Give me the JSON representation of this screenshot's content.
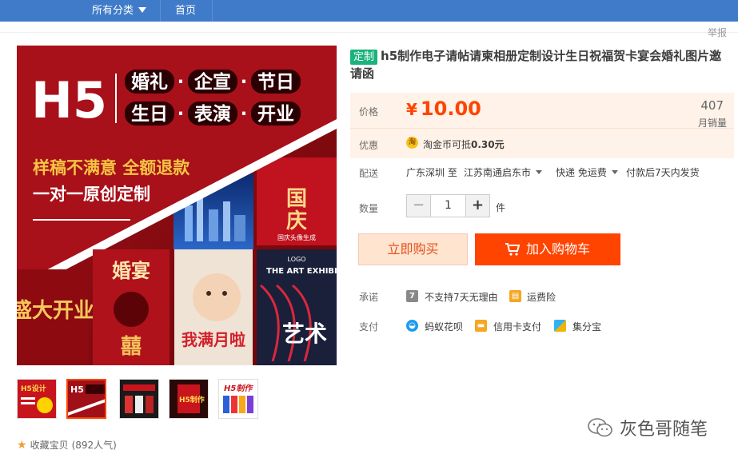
{
  "nav": {
    "categories": "所有分类",
    "home": "首页"
  },
  "report": "举报",
  "gallery": {
    "banner": {
      "h5": "H5",
      "chips_row1": [
        "婚礼",
        "·",
        "企宣",
        "·",
        "节日"
      ],
      "chips_row2": [
        "生日",
        "·",
        "表演",
        "·",
        "开业"
      ],
      "slogan1": "样稿不满意 全额退款",
      "slogan2": "一对一原创定制",
      "card_national": "国庆头像生成",
      "card_art": "THE ART EXHIBITION",
      "card_art_big": "艺术",
      "card_wedding": "婚宴",
      "card_baby": "我满月啦",
      "card_opening": "盛大开业",
      "logo": "LOGO"
    },
    "thumbs": [
      "H5设计",
      "H5",
      "",
      "H5制作",
      "H5制作"
    ]
  },
  "favorite": {
    "label": "收藏宝贝",
    "count": "(892人气)"
  },
  "product": {
    "tag": "定制",
    "title": "h5制作电子请帖请柬相册定制设计生日祝福贺卡宴会婚礼图片邀请函"
  },
  "price": {
    "label": "价格",
    "symbol": "¥",
    "value": "10.00",
    "sales": "407",
    "sales_label": "月销量"
  },
  "promo": {
    "label": "优惠",
    "coin": "淘",
    "text_pre": "淘金币可抵",
    "amount": "0.30元"
  },
  "delivery": {
    "label": "配送",
    "from": "广东深圳 至",
    "to": "江苏南通启东市",
    "method": "快递 免运费",
    "ship_time": "付款后7天内发货"
  },
  "quantity": {
    "label": "数量",
    "minus": "−",
    "value": "1",
    "plus": "+",
    "unit": "件"
  },
  "buttons": {
    "buy": "立即购买",
    "cart": "加入购物车"
  },
  "promise": {
    "label": "承诺",
    "items": [
      "不支持7天无理由",
      "运费险"
    ],
    "icon_seven": "7"
  },
  "payment": {
    "label": "支付",
    "items": [
      "蚂蚁花呗",
      "信用卡支付",
      "集分宝"
    ]
  },
  "watermark": "灰色哥随笔",
  "colors": {
    "nav": "#3f7bc8",
    "accent": "#ff4400",
    "tag": "#1ab27d",
    "price_bg": "#fff2e8"
  }
}
